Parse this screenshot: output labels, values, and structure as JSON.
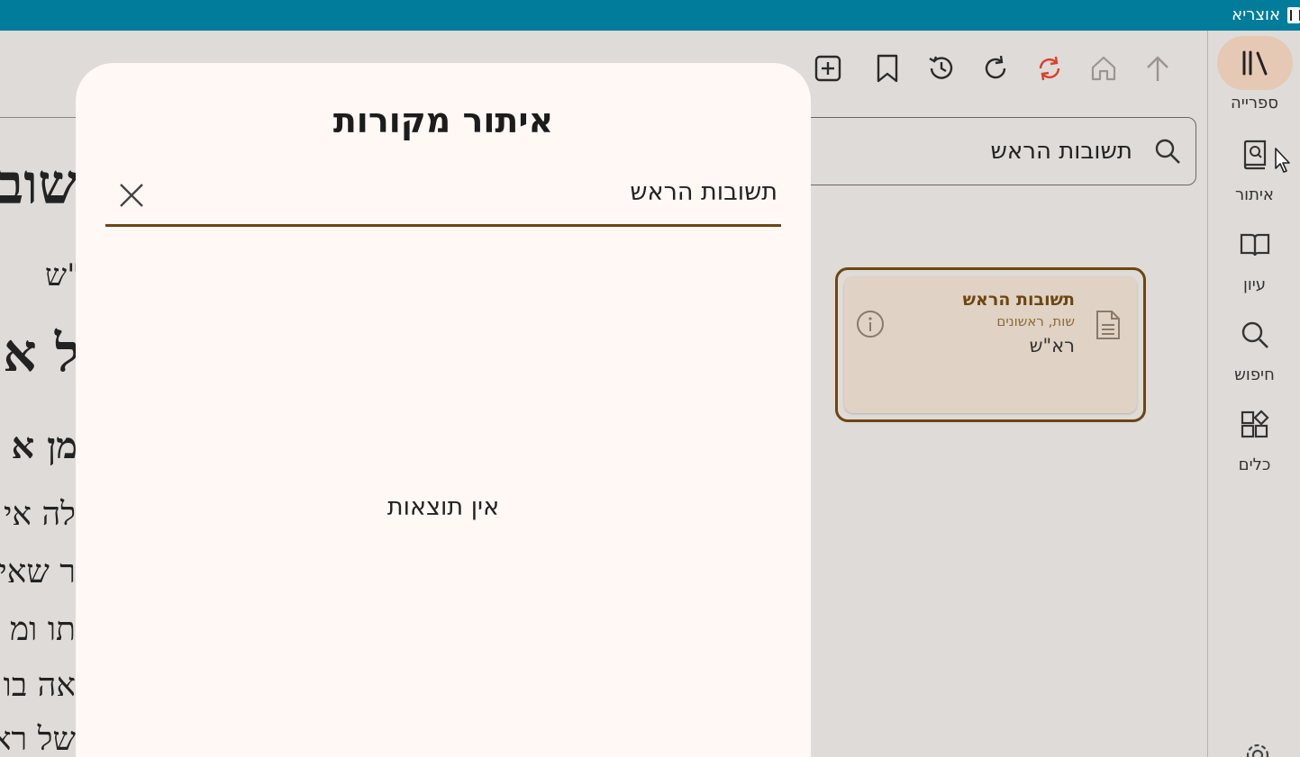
{
  "app": {
    "title": "אוצריא"
  },
  "sidebar": {
    "items": [
      {
        "label": "ספרייה",
        "icon": "library-icon",
        "active": true
      },
      {
        "label": "איתור",
        "icon": "find-book-icon",
        "active": false
      },
      {
        "label": "עיון",
        "icon": "open-book-icon",
        "active": false
      },
      {
        "label": "חיפוש",
        "icon": "search-icon",
        "active": false
      },
      {
        "label": "כלים",
        "icon": "tools-icon",
        "active": false
      }
    ],
    "bottom_icon": "settings-icon"
  },
  "toolbar": {
    "icons": [
      "add-icon",
      "bookmark-icon",
      "history-icon",
      "refresh-icon",
      "sync-icon",
      "home-icon",
      "up-arrow-icon"
    ]
  },
  "library_search": {
    "value": "תשובות הראש"
  },
  "result": {
    "title": "תשובות הראש",
    "category": "שות, ראשונים",
    "author": "רא\"ש"
  },
  "background_text": {
    "lines": [
      "שוב",
      "\"ש",
      "ל א",
      "מן א",
      "לה אי",
      "ר שאי",
      "תו ומ",
      "אה בו",
      "של רא"
    ]
  },
  "dialog": {
    "title": "איתור מקורות",
    "input_value": "תשובות הראש",
    "empty_message": "אין תוצאות"
  },
  "colors": {
    "titlebar": "#017d9b",
    "accent": "#6d4611",
    "active_nav": "#e5c9b4",
    "sync_icon": "#d9412e"
  }
}
